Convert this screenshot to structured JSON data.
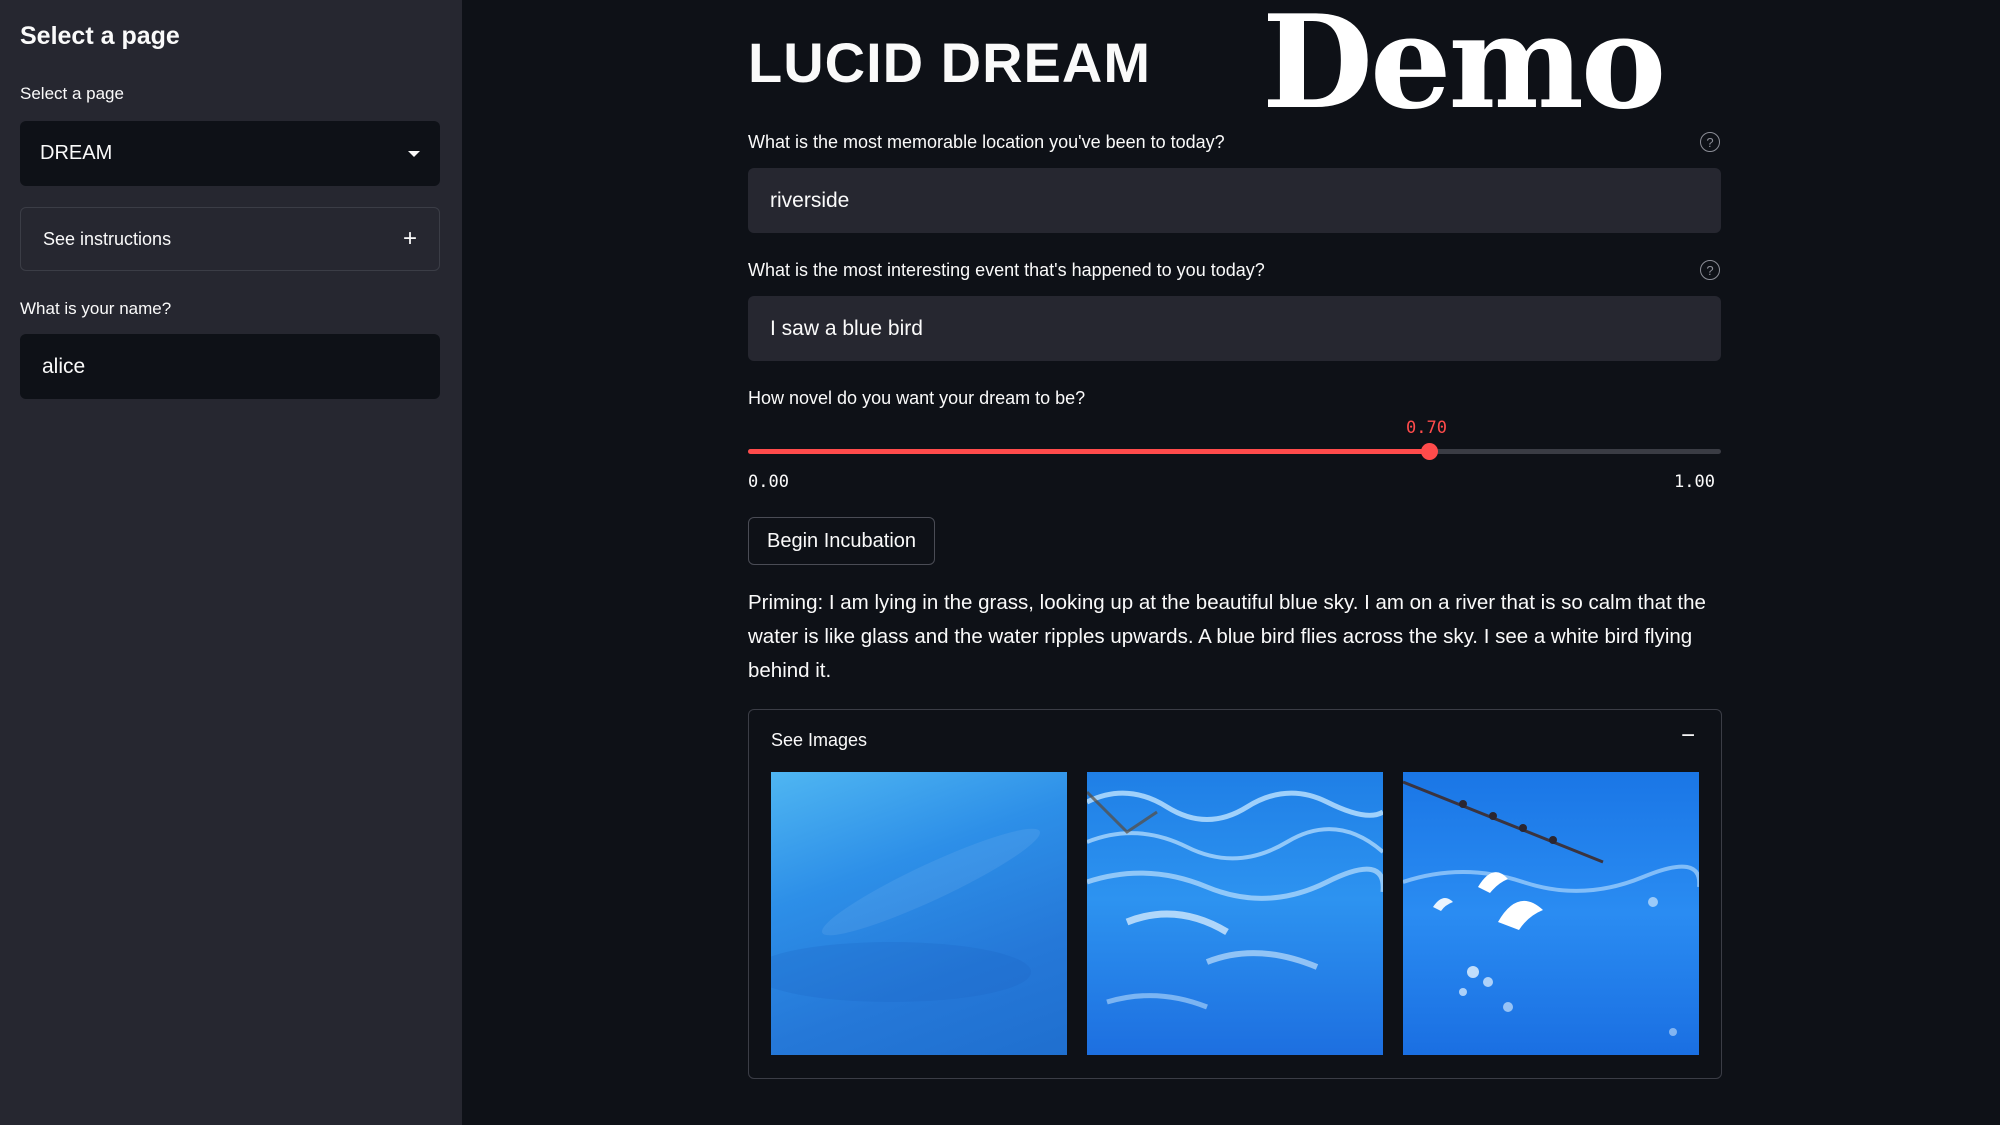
{
  "sidebar": {
    "heading": "Select a page",
    "select_label": "Select a page",
    "select_value": "DREAM",
    "instructions_label": "See instructions",
    "name_label": "What is your name?",
    "name_value": "alice"
  },
  "main": {
    "title": "LUCID DREAM",
    "overlay_text": "Demo",
    "location_label": "What is the most memorable location you've been to today?",
    "location_value": "riverside",
    "event_label": "What is the most interesting event that's happened to you today?",
    "event_value": "I saw a blue bird",
    "novelty_label": "How novel do you want your dream to be?",
    "slider": {
      "value": 0.7,
      "value_text": "0.70",
      "min_text": "0.00",
      "max_text": "1.00",
      "min": 0,
      "max": 1
    },
    "button_label": "Begin Incubation",
    "priming_text": "Priming: I am lying in the grass, looking up at the beautiful blue sky. I am on a river that is so calm that the water is like glass and the water ripples upwards. A blue bird flies across the sky. I see a white bird flying behind it.",
    "images_label": "See Images"
  },
  "icons": {
    "select_caret": "chevron-down-icon",
    "instructions_toggle": "plus-icon",
    "help": "help-circle-icon",
    "images_toggle": "minus-icon"
  },
  "colors": {
    "accent": "#ff4b4b",
    "background": "#0e1117",
    "sidebar": "#262730"
  }
}
